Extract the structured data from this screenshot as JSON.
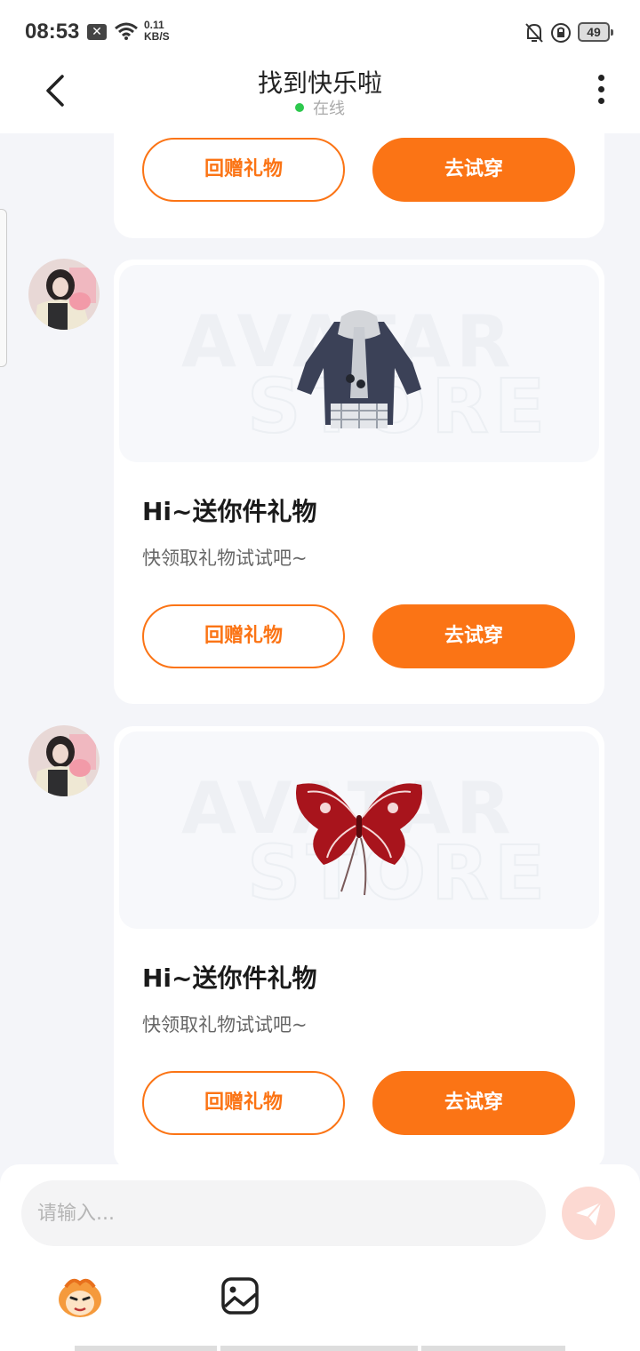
{
  "status_bar": {
    "time": "08:53",
    "speed_value": "0.11",
    "speed_unit": "KB/S",
    "battery": "49"
  },
  "header": {
    "title": "找到快乐啦",
    "status": "在线",
    "status_color": "#2dc84d"
  },
  "colors": {
    "accent": "#fb7415",
    "background": "#f4f5f9"
  },
  "messages": [
    {
      "partial": true,
      "return_gift_label": "回赠礼物",
      "try_on_label": "去试穿"
    },
    {
      "gift_item": "jacket",
      "title": "Hi~送你件礼物",
      "subtitle": "快领取礼物试试吧~",
      "return_gift_label": "回赠礼物",
      "try_on_label": "去试穿"
    },
    {
      "gift_item": "butterfly-wings",
      "title": "Hi~送你件礼物",
      "subtitle": "快领取礼物试试吧~",
      "return_gift_label": "回赠礼物",
      "try_on_label": "去试穿"
    }
  ],
  "input": {
    "placeholder": "请输入..."
  }
}
